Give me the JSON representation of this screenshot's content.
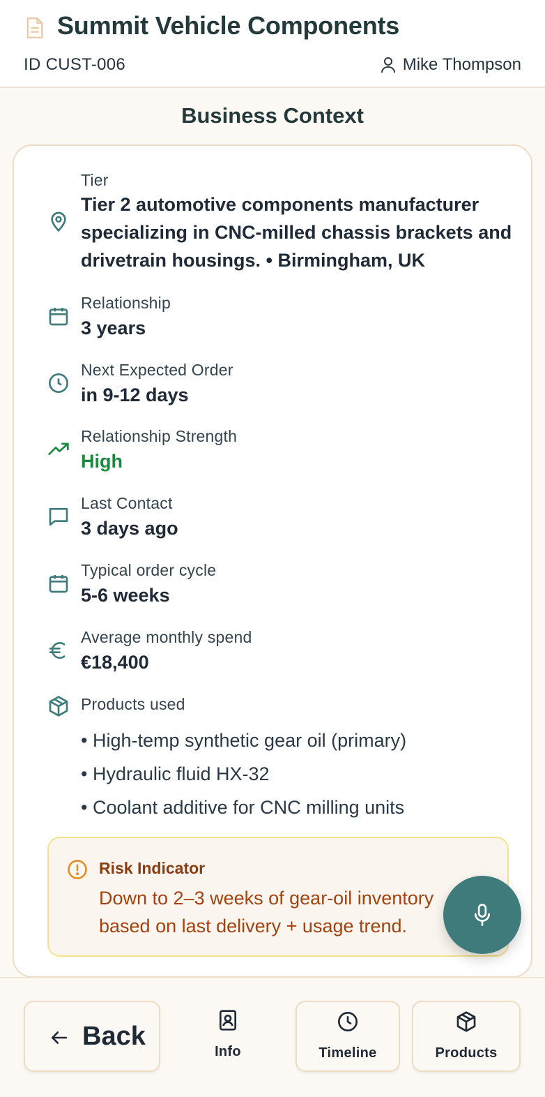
{
  "header": {
    "title": "Summit Vehicle Components",
    "customer_id": "ID CUST-006",
    "user_name": "Mike Thompson"
  },
  "section_title": "Business Context",
  "details": [
    {
      "icon": "map-pin-icon",
      "label": "Tier",
      "value": "Tier 2 automotive components manufacturer specializing in CNC-milled chassis brackets and drivetrain housings. • Birmingham, UK"
    },
    {
      "icon": "calendar-icon",
      "label": "Relationship",
      "value": "3 years"
    },
    {
      "icon": "clock-icon",
      "label": "Next Expected Order",
      "value": "in 9-12 days"
    },
    {
      "icon": "trending-up-icon",
      "label": "Relationship Strength",
      "value": "High",
      "value_color": "#1b8a3e"
    },
    {
      "icon": "message-icon",
      "label": "Last Contact",
      "value": "3 days ago"
    },
    {
      "icon": "calendar-icon",
      "label": "Typical order cycle",
      "value": "5-6 weeks"
    },
    {
      "icon": "euro-icon",
      "label": "Average monthly spend",
      "value": "€18,400"
    }
  ],
  "products": {
    "label": "Products used",
    "items": [
      "• High-temp synthetic gear oil (primary)",
      "• Hydraulic fluid HX-32",
      "• Coolant additive for CNC milling units"
    ]
  },
  "risk": {
    "title": "Risk Indicator",
    "line1": "Down to 2–3 weeks of gear-oil inventory",
    "line2": "based on last delivery + usage trend."
  },
  "bottom_nav": {
    "back_label": "Back",
    "tabs": [
      "Info",
      "Timeline",
      "Products"
    ]
  },
  "colors": {
    "accent": "#3f7b7b",
    "positive": "#1b8a3e",
    "risk_text": "#a4430f",
    "risk_border": "#f6e28a"
  }
}
